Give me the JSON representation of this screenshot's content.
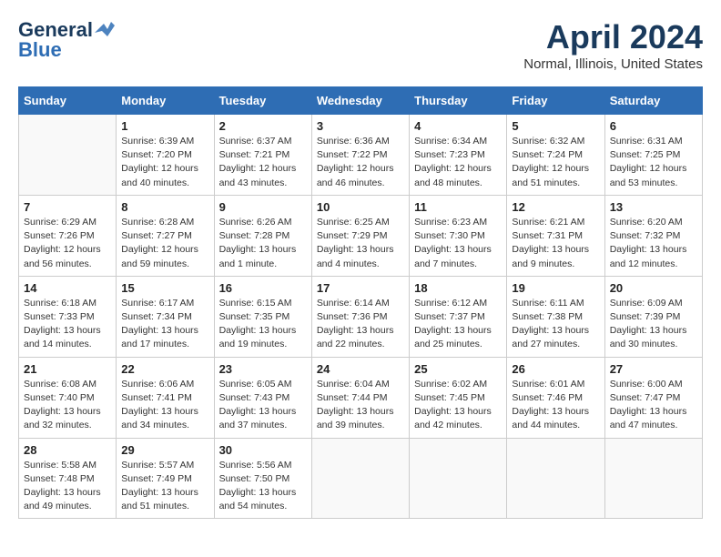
{
  "logo": {
    "line1": "General",
    "line2": "Blue"
  },
  "title": "April 2024",
  "location": "Normal, Illinois, United States",
  "weekdays": [
    "Sunday",
    "Monday",
    "Tuesday",
    "Wednesday",
    "Thursday",
    "Friday",
    "Saturday"
  ],
  "weeks": [
    [
      {
        "day": "",
        "info": ""
      },
      {
        "day": "1",
        "info": "Sunrise: 6:39 AM\nSunset: 7:20 PM\nDaylight: 12 hours\nand 40 minutes."
      },
      {
        "day": "2",
        "info": "Sunrise: 6:37 AM\nSunset: 7:21 PM\nDaylight: 12 hours\nand 43 minutes."
      },
      {
        "day": "3",
        "info": "Sunrise: 6:36 AM\nSunset: 7:22 PM\nDaylight: 12 hours\nand 46 minutes."
      },
      {
        "day": "4",
        "info": "Sunrise: 6:34 AM\nSunset: 7:23 PM\nDaylight: 12 hours\nand 48 minutes."
      },
      {
        "day": "5",
        "info": "Sunrise: 6:32 AM\nSunset: 7:24 PM\nDaylight: 12 hours\nand 51 minutes."
      },
      {
        "day": "6",
        "info": "Sunrise: 6:31 AM\nSunset: 7:25 PM\nDaylight: 12 hours\nand 53 minutes."
      }
    ],
    [
      {
        "day": "7",
        "info": "Sunrise: 6:29 AM\nSunset: 7:26 PM\nDaylight: 12 hours\nand 56 minutes."
      },
      {
        "day": "8",
        "info": "Sunrise: 6:28 AM\nSunset: 7:27 PM\nDaylight: 12 hours\nand 59 minutes."
      },
      {
        "day": "9",
        "info": "Sunrise: 6:26 AM\nSunset: 7:28 PM\nDaylight: 13 hours\nand 1 minute."
      },
      {
        "day": "10",
        "info": "Sunrise: 6:25 AM\nSunset: 7:29 PM\nDaylight: 13 hours\nand 4 minutes."
      },
      {
        "day": "11",
        "info": "Sunrise: 6:23 AM\nSunset: 7:30 PM\nDaylight: 13 hours\nand 7 minutes."
      },
      {
        "day": "12",
        "info": "Sunrise: 6:21 AM\nSunset: 7:31 PM\nDaylight: 13 hours\nand 9 minutes."
      },
      {
        "day": "13",
        "info": "Sunrise: 6:20 AM\nSunset: 7:32 PM\nDaylight: 13 hours\nand 12 minutes."
      }
    ],
    [
      {
        "day": "14",
        "info": "Sunrise: 6:18 AM\nSunset: 7:33 PM\nDaylight: 13 hours\nand 14 minutes."
      },
      {
        "day": "15",
        "info": "Sunrise: 6:17 AM\nSunset: 7:34 PM\nDaylight: 13 hours\nand 17 minutes."
      },
      {
        "day": "16",
        "info": "Sunrise: 6:15 AM\nSunset: 7:35 PM\nDaylight: 13 hours\nand 19 minutes."
      },
      {
        "day": "17",
        "info": "Sunrise: 6:14 AM\nSunset: 7:36 PM\nDaylight: 13 hours\nand 22 minutes."
      },
      {
        "day": "18",
        "info": "Sunrise: 6:12 AM\nSunset: 7:37 PM\nDaylight: 13 hours\nand 25 minutes."
      },
      {
        "day": "19",
        "info": "Sunrise: 6:11 AM\nSunset: 7:38 PM\nDaylight: 13 hours\nand 27 minutes."
      },
      {
        "day": "20",
        "info": "Sunrise: 6:09 AM\nSunset: 7:39 PM\nDaylight: 13 hours\nand 30 minutes."
      }
    ],
    [
      {
        "day": "21",
        "info": "Sunrise: 6:08 AM\nSunset: 7:40 PM\nDaylight: 13 hours\nand 32 minutes."
      },
      {
        "day": "22",
        "info": "Sunrise: 6:06 AM\nSunset: 7:41 PM\nDaylight: 13 hours\nand 34 minutes."
      },
      {
        "day": "23",
        "info": "Sunrise: 6:05 AM\nSunset: 7:43 PM\nDaylight: 13 hours\nand 37 minutes."
      },
      {
        "day": "24",
        "info": "Sunrise: 6:04 AM\nSunset: 7:44 PM\nDaylight: 13 hours\nand 39 minutes."
      },
      {
        "day": "25",
        "info": "Sunrise: 6:02 AM\nSunset: 7:45 PM\nDaylight: 13 hours\nand 42 minutes."
      },
      {
        "day": "26",
        "info": "Sunrise: 6:01 AM\nSunset: 7:46 PM\nDaylight: 13 hours\nand 44 minutes."
      },
      {
        "day": "27",
        "info": "Sunrise: 6:00 AM\nSunset: 7:47 PM\nDaylight: 13 hours\nand 47 minutes."
      }
    ],
    [
      {
        "day": "28",
        "info": "Sunrise: 5:58 AM\nSunset: 7:48 PM\nDaylight: 13 hours\nand 49 minutes."
      },
      {
        "day": "29",
        "info": "Sunrise: 5:57 AM\nSunset: 7:49 PM\nDaylight: 13 hours\nand 51 minutes."
      },
      {
        "day": "30",
        "info": "Sunrise: 5:56 AM\nSunset: 7:50 PM\nDaylight: 13 hours\nand 54 minutes."
      },
      {
        "day": "",
        "info": ""
      },
      {
        "day": "",
        "info": ""
      },
      {
        "day": "",
        "info": ""
      },
      {
        "day": "",
        "info": ""
      }
    ]
  ]
}
